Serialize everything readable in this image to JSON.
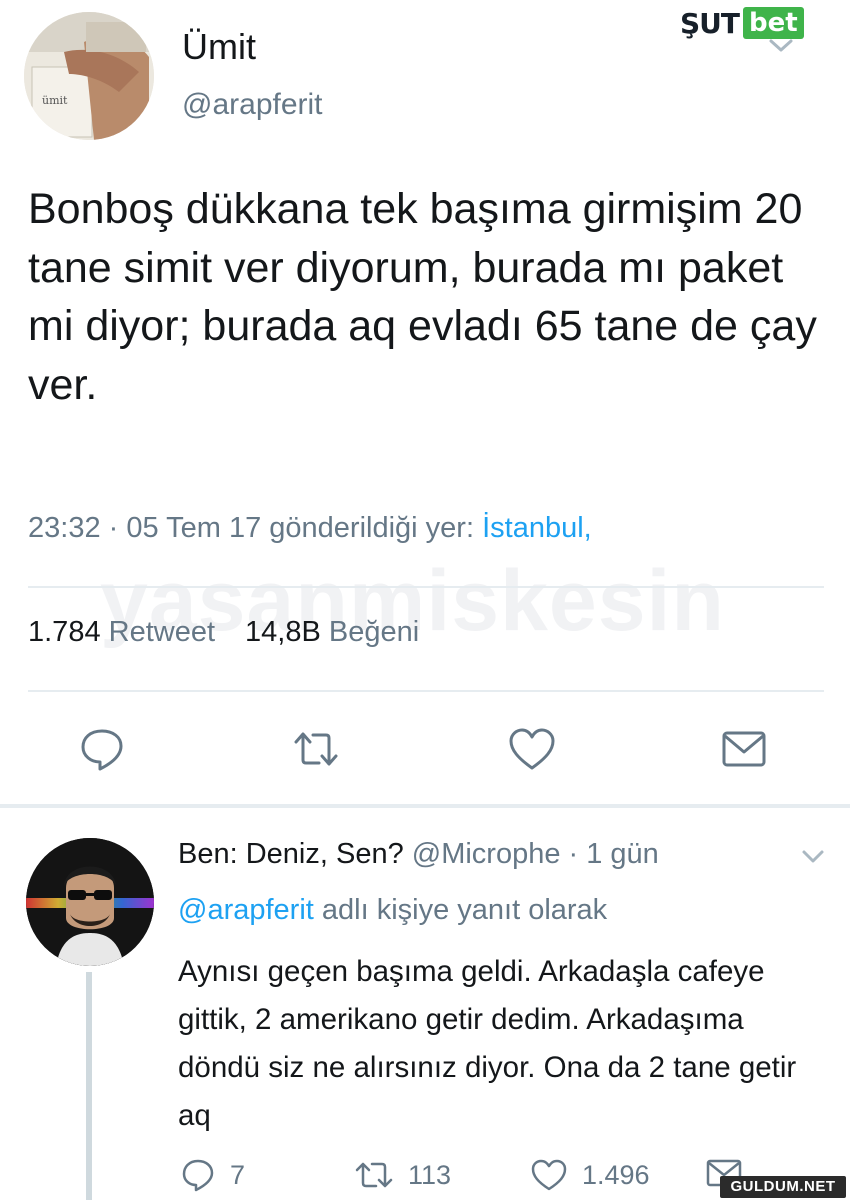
{
  "brand": {
    "part1": "ŞUT",
    "part2": "bet"
  },
  "tweet": {
    "author_name": "Ümit",
    "author_handle": "@arapferit",
    "text": "Bonboş dükkana tek başıma girmişim 20 tane simit ver diyorum, burada mı paket mi diyor; burada aq evladı 65 tane de çay ver.",
    "meta_time": "23:32 · 05 Tem 17 gönderildiği yer: ",
    "meta_location": "İstanbul,",
    "retweet_count": "1.784",
    "retweet_label": "Retweet",
    "like_count": "14,8B",
    "like_label": "Beğeni",
    "actions": [
      "reply-icon",
      "retweet-icon",
      "like-icon",
      "message-icon"
    ]
  },
  "watermark": "yasanmiskesin",
  "reply": {
    "name": "Ben: Deniz, Sen?",
    "handle_time": " @Microphe · 1 gün",
    "reply_to_handle": "@arapferit",
    "reply_to_suffix": " adlı kişiye yanıt olarak",
    "text": "Aynısı geçen başıma geldi. Arkadaşla cafeye gittik, 2 amerikano getir dedim. Arkadaşıma döndü siz ne alırsınız diyor. Ona da 2 tane getir aq",
    "reply_count": "7",
    "retweet_count": "113",
    "like_count": "1.496"
  },
  "footer_badge": "GULDUM.NET",
  "colors": {
    "text": "#14171a",
    "muted": "#657786",
    "link": "#1da1f2",
    "divider": "#e6ecf0",
    "brand_green": "#3fb44a"
  }
}
